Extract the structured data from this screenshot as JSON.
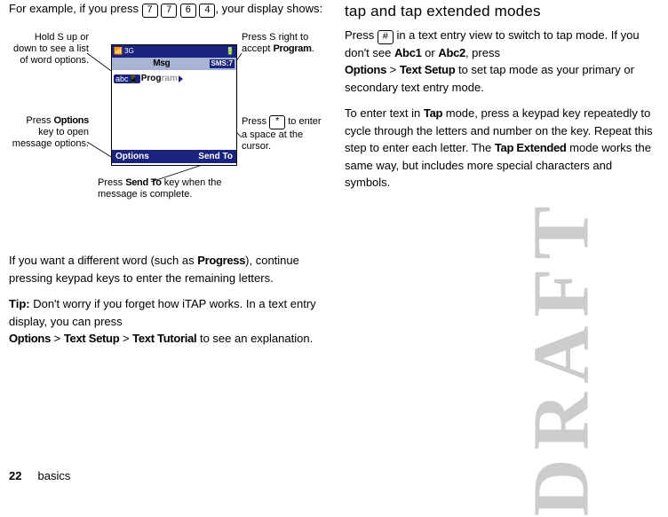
{
  "left": {
    "intro_pre": "For example, if you press ",
    "keys": [
      "7",
      "7",
      "6",
      "4"
    ],
    "intro_post": ", your display shows:",
    "callouts": {
      "hold_up": "Hold S up or down to see a list of word options.",
      "options_key": "Press Options key to open message options.",
      "press_right_pre": "Press S right to accept ",
      "press_right_bold": "Program",
      "press_right_post": ".",
      "press_star_pre": "Press ",
      "press_star_key": "*",
      "press_star_post": " to enter a space at the cursor.",
      "sendto_pre": "Press ",
      "sendto_bold": "Send To",
      "sendto_post": " key when the message is complete."
    },
    "phone": {
      "status_left": "📶 3G",
      "status_right": "🔋",
      "title_left": "Msg",
      "title_right": "SMS:7",
      "abc": "abc📱",
      "word_typed": "Prog",
      "word_ghost": "ram",
      "soft_left": "Options",
      "soft_right": "Send To"
    },
    "after_diag_pre": "If you want a different word (such as ",
    "after_diag_bold": "Progress",
    "after_diag_post": "), continue pressing keypad keys to enter the remaining letters.",
    "tip_pre": "Tip:",
    "tip_body": " Don't worry if you forget how iTAP works. In a text entry display, you can press ",
    "tip_path1": "Options",
    "tip_sep": " > ",
    "tip_path2": "Text Setup",
    "tip_path3": "Text Tutorial",
    "tip_end": " to see an explanation."
  },
  "right": {
    "heading": "tap and tap extended modes",
    "p1_pre": "Press ",
    "p1_key": "#",
    "p1_mid": " in a text entry view to switch to tap mode. If you don't see ",
    "p1_abc1": "Abc1",
    "p1_or": " or ",
    "p1_abc2": "Abc2",
    "p1_post": ", press ",
    "p1_options": "Options",
    "p1_sep": " > ",
    "p1_textsetup": "Text Setup",
    "p1_end": " to set tap mode as your primary or secondary text entry mode.",
    "p2_pre": "To enter text in ",
    "p2_tap": "Tap",
    "p2_mid": " mode, press a keypad key repeatedly to cycle through the letters and number on the key. Repeat this step to enter each letter. The ",
    "p2_tapext": "Tap Extended",
    "p2_end": " mode works the same way, but includes more special characters and symbols."
  },
  "footer": {
    "page": "22",
    "section": "basics"
  },
  "watermark": "DRAFT"
}
